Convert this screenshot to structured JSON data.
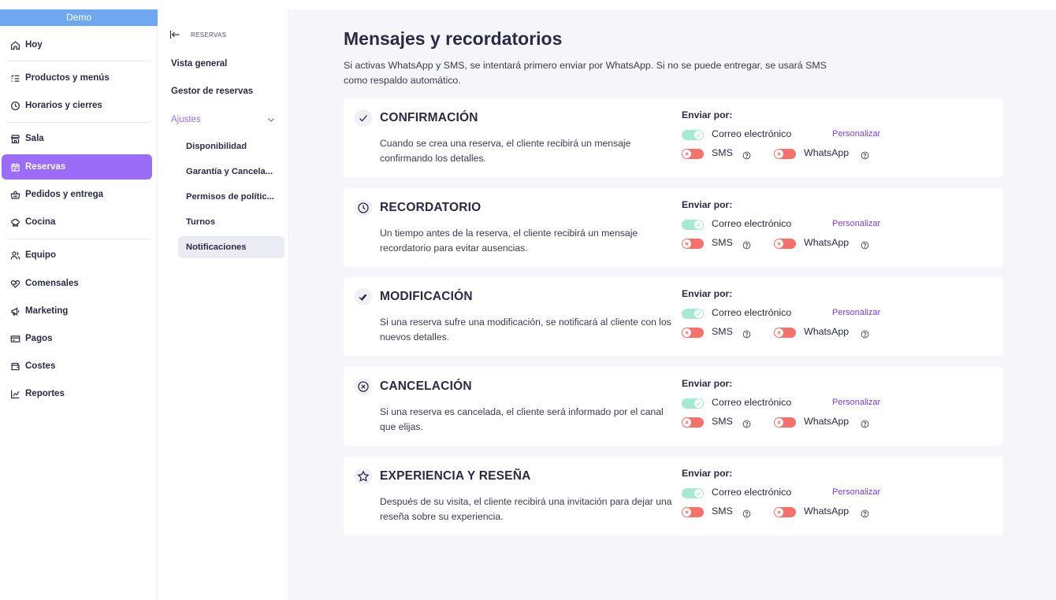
{
  "sidebar": {
    "demo_label": "Demo",
    "items": [
      {
        "label": "Hoy",
        "icon": "home-icon"
      },
      {
        "label": "Productos y menús",
        "icon": "list-icon"
      },
      {
        "label": "Horarios y cierres",
        "icon": "clock-icon"
      },
      {
        "label": "Sala",
        "icon": "store-icon"
      },
      {
        "label": "Reservas",
        "icon": "calendar-icon",
        "active": true
      },
      {
        "label": "Pedidos y entrega",
        "icon": "basket-icon"
      },
      {
        "label": "Cocina",
        "icon": "chef-hat-icon"
      },
      {
        "label": "Equipo",
        "icon": "team-icon"
      },
      {
        "label": "Comensales",
        "icon": "heart-icon"
      },
      {
        "label": "Marketing",
        "icon": "megaphone-icon"
      },
      {
        "label": "Pagos",
        "icon": "card-icon"
      },
      {
        "label": "Costes",
        "icon": "wallet-icon"
      },
      {
        "label": "Reportes",
        "icon": "chart-icon"
      }
    ]
  },
  "subnav": {
    "back_label": "RESERVAS",
    "items": [
      {
        "label": "Vista general"
      },
      {
        "label": "Gestor de reservas"
      },
      {
        "label": "Ajustes"
      }
    ],
    "children": [
      {
        "label": "Disponibilidad"
      },
      {
        "label": "Garantía y Cancela..."
      },
      {
        "label": "Permisos de polític..."
      },
      {
        "label": "Turnos"
      },
      {
        "label": "Notificaciones",
        "selected": true
      }
    ]
  },
  "main": {
    "title": "Mensajes y recordatorios",
    "description": "Si activas WhatsApp y SMS, se intentará primero enviar por WhatsApp. Si no se puede entregar, se usará SMS como respaldo automático.",
    "send_label": "Enviar por:",
    "email_label": "Correo electrónico",
    "sms_label": "SMS",
    "whatsapp_label": "WhatsApp",
    "personalize_label": "Personalizar",
    "cards": [
      {
        "title": "CONFIRMACIÓN",
        "icon": "check-icon",
        "description": "Cuando se crea una reserva, el cliente recibirá un mensaje confirmando los detalles.",
        "email": true,
        "sms": false,
        "whatsapp": false
      },
      {
        "title": "RECORDATORIO",
        "icon": "clock-icon",
        "description": "Un tiempo antes de la reserva, el cliente recibirá un mensaje recordatorio para evitar ausencias.",
        "email": true,
        "sms": false,
        "whatsapp": false
      },
      {
        "title": "MODIFICACIÓN",
        "icon": "double-check-icon",
        "description": "Si una reserva sufre una modificación, se notificará al cliente con los nuevos detalles.",
        "email": true,
        "sms": false,
        "whatsapp": false
      },
      {
        "title": "CANCELACIÓN",
        "icon": "x-circle-icon",
        "description": "Si una reserva es cancelada, el cliente será informado por el canal que elijas.",
        "email": true,
        "sms": false,
        "whatsapp": false
      },
      {
        "title": "EXPERIENCIA Y RESEÑA",
        "icon": "star-icon",
        "description": "Después de su visita, el cliente recibirá una invitación para dejar una reseña sobre su experiencia.",
        "email": true,
        "sms": false,
        "whatsapp": false
      }
    ]
  },
  "colors": {
    "accent": "#9b6cf7",
    "demo_bar": "#6fa8f0",
    "toggle_on": "#a6ead3",
    "toggle_off": "#f4716c",
    "link": "#7a3cf0",
    "main_bg": "#f5f5fa"
  }
}
